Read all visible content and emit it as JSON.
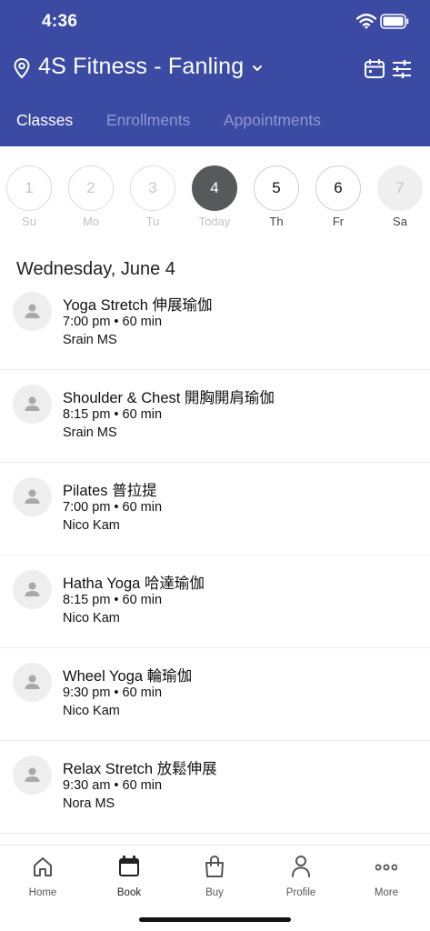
{
  "status_bar": {
    "time": "4:36"
  },
  "header": {
    "location": "4S Fitness - Fanling",
    "icons": [
      "location-pin-icon",
      "chevron-down-icon",
      "calendar-icon",
      "filter-sliders-icon"
    ]
  },
  "tabs": [
    {
      "label": "Classes",
      "active": true
    },
    {
      "label": "Enrollments",
      "active": false
    },
    {
      "label": "Appointments",
      "active": false
    }
  ],
  "week": [
    {
      "number": "1",
      "label": "Su",
      "state": "past"
    },
    {
      "number": "2",
      "label": "Mo",
      "state": "past"
    },
    {
      "number": "3",
      "label": "Tu",
      "state": "past"
    },
    {
      "number": "4",
      "label": "Today",
      "state": "today"
    },
    {
      "number": "5",
      "label": "Th",
      "state": "future"
    },
    {
      "number": "6",
      "label": "Fr",
      "state": "future"
    },
    {
      "number": "7",
      "label": "Sa",
      "state": "disabled"
    }
  ],
  "date_heading": "Wednesday, June 4",
  "classes": [
    {
      "name": "Yoga Stretch 伸展瑜伽",
      "time": "7:00 pm • 60 min",
      "instructor": "Srain MS"
    },
    {
      "name": "Shoulder & Chest 開胸開肩瑜伽",
      "time": "8:15 pm • 60 min",
      "instructor": "Srain MS"
    },
    {
      "name": "Pilates 普拉提",
      "time": "7:00 pm • 60 min",
      "instructor": "Nico Kam"
    },
    {
      "name": "Hatha Yoga 哈達瑜伽",
      "time": "8:15 pm • 60 min",
      "instructor": "Nico Kam"
    },
    {
      "name": "Wheel Yoga 輪瑜伽",
      "time": "9:30 pm • 60 min",
      "instructor": "Nico Kam"
    },
    {
      "name": "Relax Stretch 放鬆伸展",
      "time": "9:30 am • 60 min",
      "instructor": "Nora MS"
    }
  ],
  "bottom_nav": [
    {
      "label": "Home",
      "icon": "home-icon",
      "active": false
    },
    {
      "label": "Book",
      "icon": "calendar-icon",
      "active": true
    },
    {
      "label": "Buy",
      "icon": "shopping-bag-icon",
      "active": false
    },
    {
      "label": "Profile",
      "icon": "person-icon",
      "active": false
    },
    {
      "label": "More",
      "icon": "more-dots-icon",
      "active": false
    }
  ],
  "colors": {
    "header_bg": "#3b4ba3",
    "today_circle": "#58595b",
    "tab_inactive": "#8e98cf"
  }
}
